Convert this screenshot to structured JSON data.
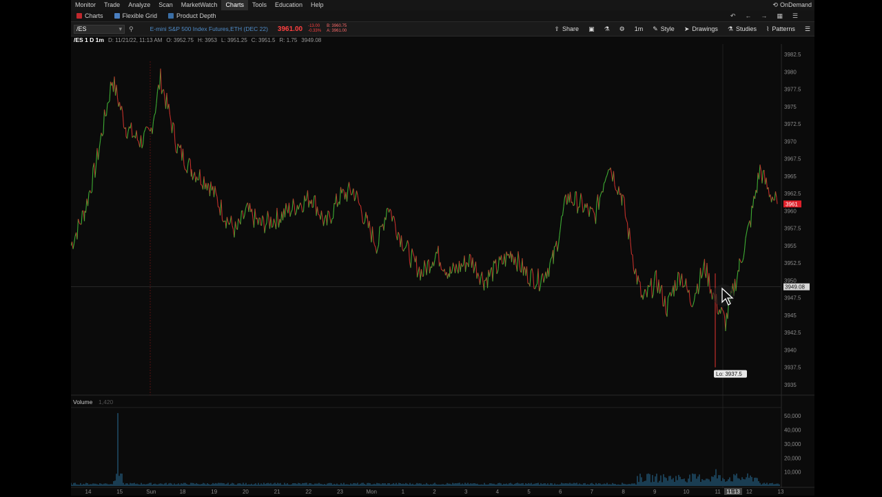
{
  "menubar": {
    "items": [
      "Monitor",
      "Trade",
      "Analyze",
      "Scan",
      "MarketWatch",
      "Charts",
      "Tools",
      "Education",
      "Help"
    ],
    "active": "Charts",
    "right_label": "OnDemand"
  },
  "subtabs": [
    {
      "label": "Charts",
      "color": "#c0282d"
    },
    {
      "label": "Flexible Grid",
      "color": "#4a7fc1"
    },
    {
      "label": "Product Depth",
      "color": "#3a6ea5"
    }
  ],
  "toolbar": {
    "symbol": "/ES",
    "description": "E-mini S&P 500 Index Futures,ETH (DEC 22)",
    "price": "3961.00",
    "change": "-13.00",
    "change_pct": "-0.33%",
    "bid": "B: 3960.75",
    "ask": "A: 3961.00",
    "share_label": "Share",
    "timeframe": "1m",
    "style_label": "Style",
    "drawings_label": "Drawings",
    "studies_label": "Studies",
    "patterns_label": "Patterns"
  },
  "infobar": {
    "symbol": "/ES 1 D 1m",
    "date": "D: 11/21/22, 11:13 AM",
    "open": "O: 3952.75",
    "high": "H: 3953",
    "low": "L: 3951.25",
    "close": "C: 3951.5",
    "range": "R: 1.75",
    "last": "3949.08"
  },
  "volume_panel": {
    "label": "Volume",
    "value": "1,420"
  },
  "chart_data": {
    "type": "line",
    "series": [
      {
        "x": [
          0,
          20,
          35,
          60,
          80,
          100,
          115,
          130,
          155,
          175,
          200,
          225,
          240,
          255,
          275,
          300,
          330,
          350,
          370,
          390,
          410,
          430,
          445,
          460,
          475,
          495,
          510,
          530,
          550,
          565,
          580,
          600,
          620,
          640,
          660,
          680,
          700,
          720,
          740,
          760,
          780,
          800,
          820,
          830,
          850,
          865,
          875,
          885,
          900,
          920,
          935,
          950,
          970,
          985,
          1000,
          1012,
          1025
        ],
        "y": [
          3955,
          3960,
          3966,
          3979,
          3972,
          3970,
          3971,
          3979,
          3969,
          3966,
          3964,
          3959,
          3957,
          3960,
          3958,
          3959,
          3961,
          3962,
          3958,
          3962,
          3963,
          3958,
          3955,
          3961,
          3957,
          3953,
          3951,
          3954,
          3951,
          3952,
          3953,
          3950,
          3952,
          3954,
          3951,
          3950,
          3953,
          3962,
          3961,
          3959,
          3967,
          3962,
          3951,
          3947,
          3950,
          3946,
          3949,
          3951,
          3947,
          3952,
          3947,
          3944,
          3952,
          3958,
          3966,
          3963,
          3961
        ]
      }
    ],
    "y_ticks": [
      "3982.5",
      "3980",
      "3977.5",
      "3975",
      "3972.5",
      "3970",
      "3967.5",
      "3965",
      "3962.5",
      "3960",
      "3957.5",
      "3955",
      "3952.5",
      "3950",
      "3947.5",
      "3945",
      "3942.5",
      "3940",
      "3937.5",
      "3935"
    ],
    "ylim": [
      3933.5,
      3984
    ],
    "x_ticks": [
      "14",
      "15",
      "Sun",
      "18",
      "19",
      "20",
      "21",
      "22",
      "23",
      "Mon",
      "1",
      "2",
      "3",
      "4",
      "5",
      "6",
      "7",
      "8",
      "9",
      "10",
      "11",
      "12",
      "13"
    ],
    "x_tick_highlight": "11:13",
    "volume_ticks": [
      "50,000",
      "40,000",
      "30,000",
      "20,000",
      "10,000"
    ],
    "price_label": "3961",
    "crosshair_label": "3949.08",
    "low_label": "Lo: 3937.5",
    "low_value": 3937.5,
    "last_value": 3961,
    "crosshair_value": 3949.08,
    "colors": {
      "up": "#3fae34",
      "down": "#c4302b",
      "price_tag": "#e0202a",
      "volume": "#2a6f9a"
    }
  }
}
